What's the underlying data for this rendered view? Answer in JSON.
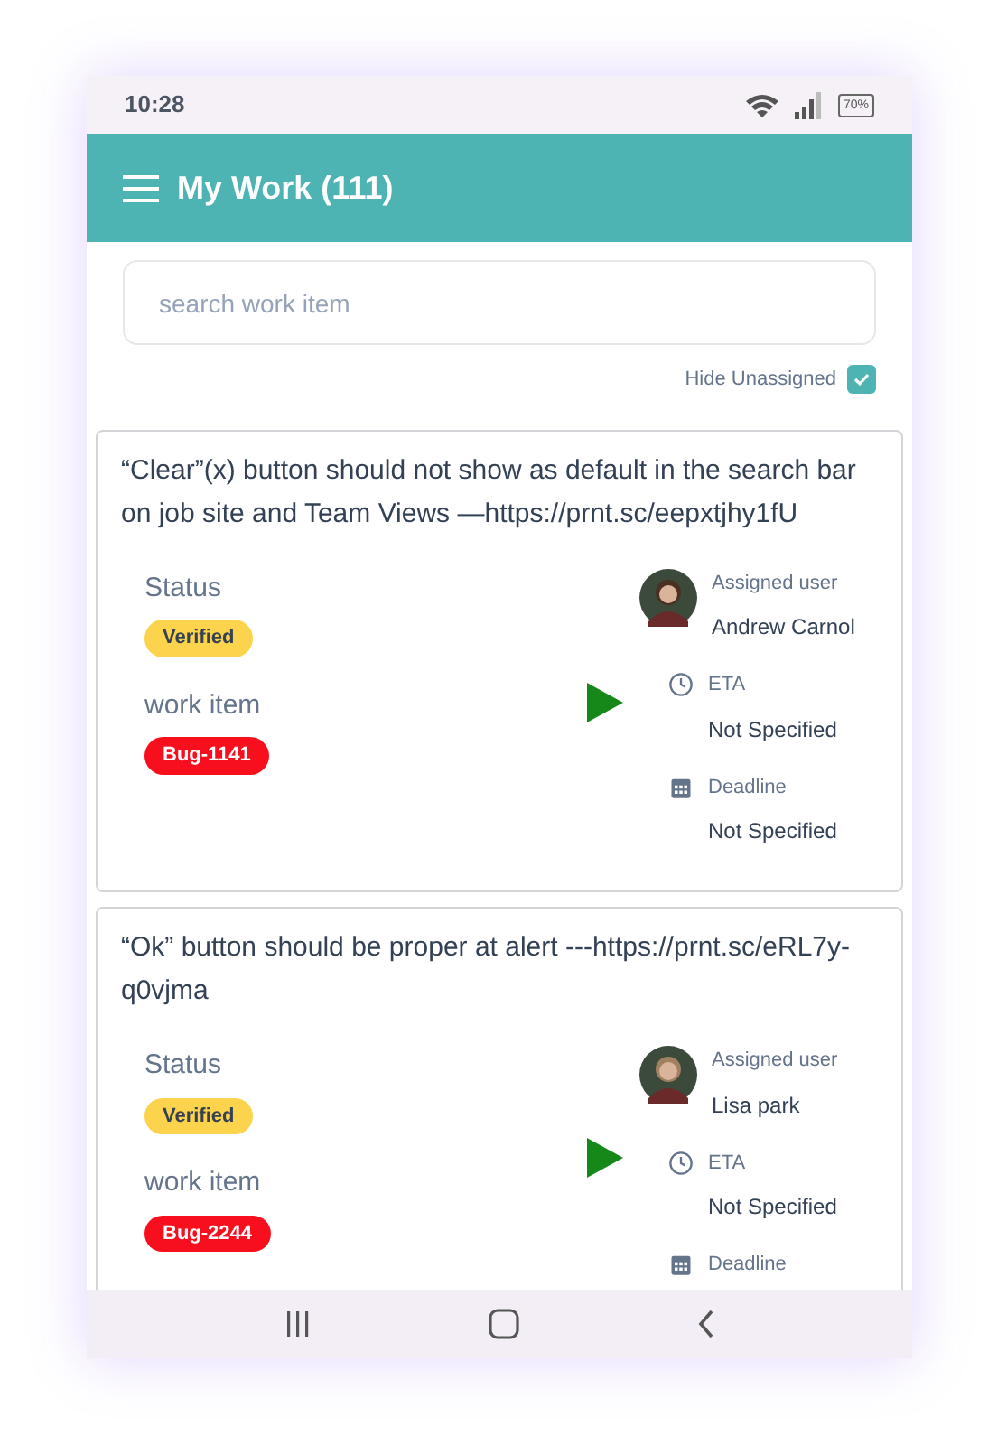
{
  "status_bar": {
    "time": "10:28",
    "battery": "70%"
  },
  "header": {
    "title": "My Work (111)"
  },
  "search": {
    "placeholder": "search work item"
  },
  "hide_unassigned": {
    "label": "Hide Unassigned",
    "checked": true
  },
  "cards": [
    {
      "title": "“Clear”(x) button should  not show as default in the search bar on job site and Team Views —https://prnt.sc/eepxtjhy1fU",
      "status_label": "Status",
      "status": "Verified",
      "work_item_label": "work item",
      "work_item": "Bug-1141",
      "assigned_label": "Assigned user",
      "assignee": "Andrew Carnol",
      "eta_label": "ETA",
      "eta": "Not Specified",
      "deadline_label": "Deadline",
      "deadline": "Not Specified"
    },
    {
      "title": "“Ok” button should be proper at alert ---https://prnt.sc/eRL7y-q0vjma",
      "status_label": "Status",
      "status": "Verified",
      "work_item_label": "work item",
      "work_item": "Bug-2244",
      "assigned_label": "Assigned user",
      "assignee": "Lisa park",
      "eta_label": "ETA",
      "eta": "Not Specified",
      "deadline_label": "Deadline"
    }
  ]
}
